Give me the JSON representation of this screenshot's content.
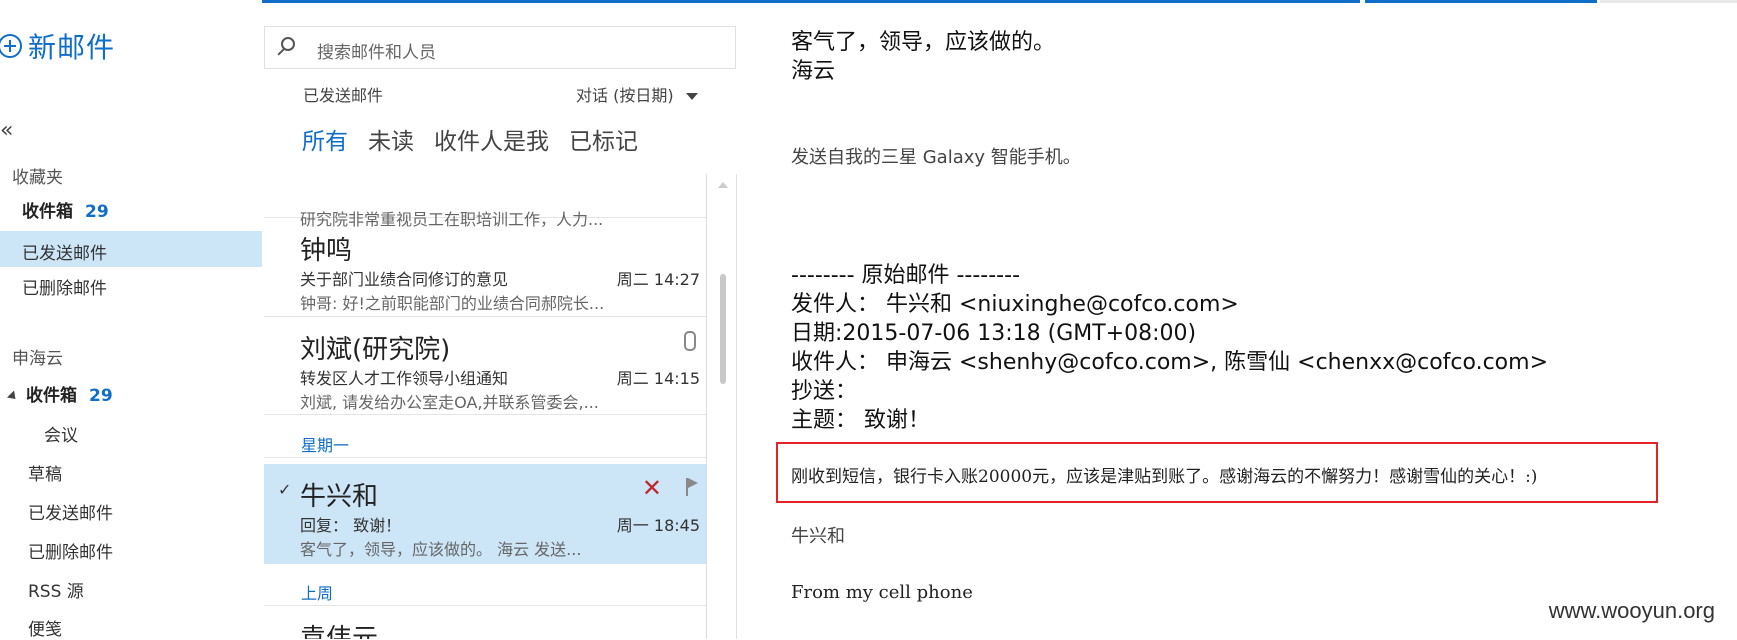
{
  "nav": {
    "new_mail": "新邮件",
    "collapse": "«",
    "favorites_header": "收藏夹",
    "favorites": [
      {
        "label": "收件箱",
        "count": "29"
      },
      {
        "label": "已发送邮件"
      },
      {
        "label": "已删除邮件"
      }
    ],
    "account_header": "申海云",
    "folders": [
      {
        "label": "收件箱",
        "count": "29"
      },
      {
        "label": "会议"
      },
      {
        "label": "草稿"
      },
      {
        "label": "已发送邮件"
      },
      {
        "label": "已删除邮件"
      },
      {
        "label": "RSS 源"
      },
      {
        "label": "便笺"
      }
    ]
  },
  "search": {
    "placeholder": "搜索邮件和人员"
  },
  "list_header": {
    "folder": "已发送邮件",
    "sort": "对话 (按日期)"
  },
  "filters": [
    "所有",
    "未读",
    "收件人是我",
    "已标记"
  ],
  "messages": [
    {
      "preview": "研究院非常重视员工在职培训工作，人力..."
    },
    {
      "sender": "钟鸣",
      "subject": "关于部门业绩合同修订的意见",
      "time": "周二 14:27",
      "preview": "钟哥: 好!之前职能部门的业绩合同郝院长..."
    },
    {
      "sender": "刘斌(研究院)",
      "subject": "转发区人才工作领导小组通知",
      "time": "周二 14:15",
      "preview": "刘斌, 请发给办公室走OA,并联系管委会,..."
    },
    {
      "sender": "牛兴和",
      "subject": "回复： 致谢！",
      "time": "周一 18:45",
      "preview": "客气了，领导，应该做的。 海云   发送..."
    },
    {
      "sender": "袁伟元"
    }
  ],
  "groups": [
    "星期一",
    "上周"
  ],
  "reading": {
    "line1": "客气了，领导，应该做的。",
    "line2": "海云",
    "sent_from": "发送自我的三星 Galaxy 智能手机。",
    "original": "-------- 原始邮件 --------",
    "from": "发件人： 牛兴和 <niuxinghe@cofco.com>",
    "date": "日期:2015-07-06 13:18 (GMT+08:00)",
    "to": "收件人： 申海云 <shenhy@cofco.com>, 陈雪仙 <chenxx@cofco.com>",
    "cc": "抄送：",
    "subject": "主题： 致谢！",
    "body": "刚收到短信，银行卡入账20000元，应该是津贴到账了。感谢海云的不懈努力！感谢雪仙的关心！:)",
    "signature": "牛兴和",
    "footer": "From my cell phone"
  },
  "watermark": "www.wooyun.org",
  "colors": {
    "accent": "#0f6ec7",
    "selected": "#cde6f7",
    "highlight_box": "#e42228"
  }
}
